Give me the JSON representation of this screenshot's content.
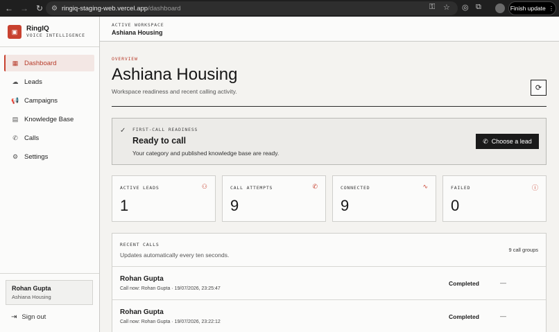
{
  "browser": {
    "url_host": "ringiq-staging-web.vercel.app",
    "url_path": "/dashboard",
    "finish_update_label": "Finish update"
  },
  "brand": {
    "name": "RingIQ",
    "tagline": "VOICE INTELLIGENCE"
  },
  "sidebar": {
    "items": [
      {
        "label": "Dashboard",
        "icon": "grid-icon",
        "active": true
      },
      {
        "label": "Leads",
        "icon": "cloud-upload-icon",
        "active": false
      },
      {
        "label": "Campaigns",
        "icon": "megaphone-icon",
        "active": false
      },
      {
        "label": "Knowledge Base",
        "icon": "book-icon",
        "active": false
      },
      {
        "label": "Calls",
        "icon": "phone-icon",
        "active": false
      },
      {
        "label": "Settings",
        "icon": "gear-icon",
        "active": false
      }
    ],
    "user_name": "Rohan Gupta",
    "user_workspace": "Ashiana Housing",
    "sign_out_label": "Sign out"
  },
  "topbar": {
    "label": "ACTIVE WORKSPACE",
    "workspace": "Ashiana Housing"
  },
  "overview": {
    "eyebrow": "OVERVIEW",
    "title": "Ashiana Housing",
    "subtitle": "Workspace readiness and recent calling activity."
  },
  "readiness": {
    "label": "FIRST-CALL READINESS",
    "title": "Ready to call",
    "description": "Your category and published knowledge base are ready.",
    "button_label": "Choose a lead"
  },
  "stats": [
    {
      "label": "ACTIVE LEADS",
      "value": "1",
      "icon": "users-icon"
    },
    {
      "label": "CALL ATTEMPTS",
      "value": "9",
      "icon": "phone-ringing-icon"
    },
    {
      "label": "CONNECTED",
      "value": "9",
      "icon": "activity-icon"
    },
    {
      "label": "FAILED",
      "value": "0",
      "icon": "alert-circle-icon"
    }
  ],
  "recent_calls": {
    "label": "RECENT CALLS",
    "subtitle": "Updates automatically every ten seconds.",
    "count": "9 call groups",
    "rows": [
      {
        "name": "Rohan Gupta",
        "meta": "Call now: Rohan Gupta · 19/07/2026, 23:25:47",
        "status": "Completed",
        "extra": "—"
      },
      {
        "name": "Rohan Gupta",
        "meta": "Call now: Rohan Gupta · 19/07/2026, 23:22:12",
        "status": "Completed",
        "extra": "—"
      }
    ]
  },
  "colors": {
    "accent": "#c8412f",
    "background": "#f4f3f0",
    "button_dark": "#1a1a1a"
  }
}
